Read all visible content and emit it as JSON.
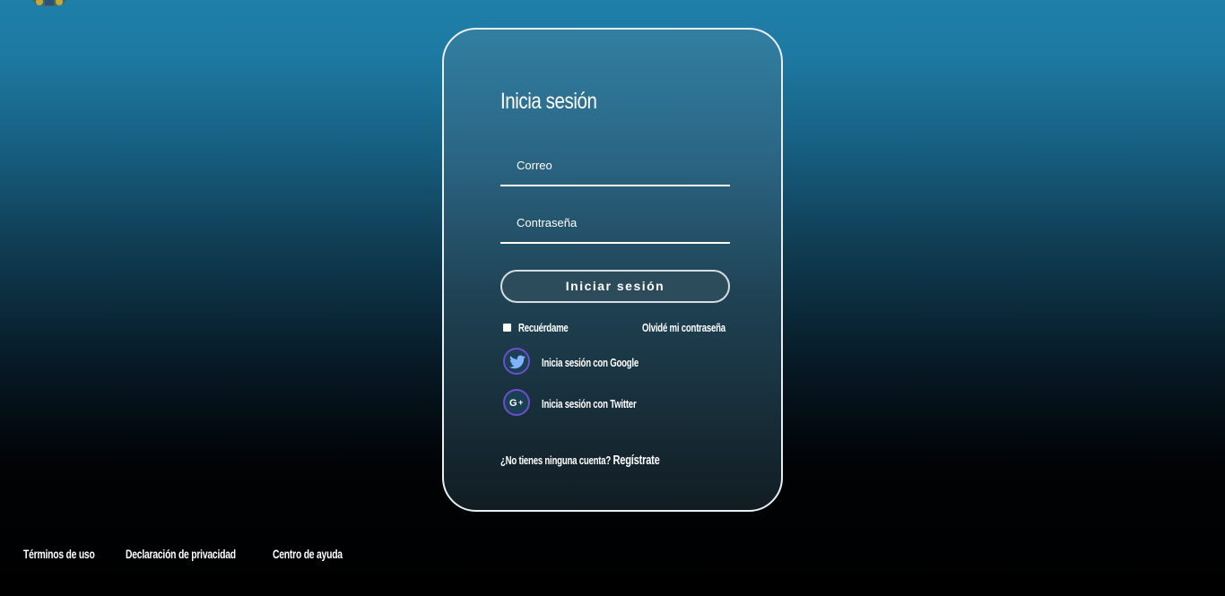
{
  "login": {
    "title": "Inicia sesión",
    "email_placeholder": "Correo",
    "password_placeholder": "Contraseña",
    "submit_label": "Iniciar sesión",
    "remember_label": "Recuérdame",
    "forgot_label": "Olvidé mi contraseña",
    "social": [
      {
        "label": "Inicia sesión con Google",
        "icon": "twitter-bird-icon"
      },
      {
        "label": "Inicia sesión con Twitter",
        "icon": "google-plus-icon"
      }
    ],
    "signup_prompt": "¿No tienes ninguna cuenta?",
    "signup_link": "Regístrate"
  },
  "footer": {
    "links": [
      "Términos de uso",
      "Declaración de privacidad",
      "Centro de ayuda"
    ]
  },
  "colors": {
    "background_top": "#1f7fa9",
    "background_bottom": "#000000",
    "icon_ring": "#6a4fd0",
    "twitter_bird": "#7fb2ff",
    "text": "#ffffff"
  }
}
